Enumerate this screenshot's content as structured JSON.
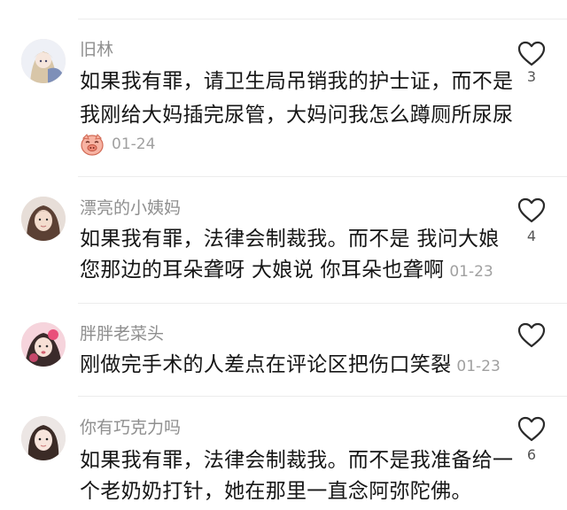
{
  "comments": [
    {
      "username": "旧林",
      "lines": [
        "如果我有罪，请卫生局吊销我的护士证，而不是",
        "我刚给大妈插完尿管，大妈问我怎么蹲厕所尿尿"
      ],
      "sticker": "pig-emoji-icon",
      "date": "01-24",
      "likes": "3"
    },
    {
      "username": "漂亮的小姨妈",
      "lines": [
        "如果我有罪，法律会制裁我。而不是 我问大娘",
        "您那边的耳朵聋呀 大娘说 你耳朵也聋啊"
      ],
      "date": "01-23",
      "likes": "4"
    },
    {
      "username": "胖胖老菜头",
      "lines": [
        "刚做完手术的人差点在评论区把伤口笑裂"
      ],
      "date": "01-23",
      "likes": ""
    },
    {
      "username": "你有巧克力吗",
      "lines": [
        "如果我有罪，法律会制裁我。而不是我准备给一",
        "个老奶奶打针，她在那里一直念阿弥陀佛。"
      ],
      "date": "",
      "likes": "6"
    }
  ],
  "colors": {
    "username": "#8f8f8f",
    "text": "#161616",
    "date": "#a0a0a0",
    "divider": "#ececec"
  }
}
